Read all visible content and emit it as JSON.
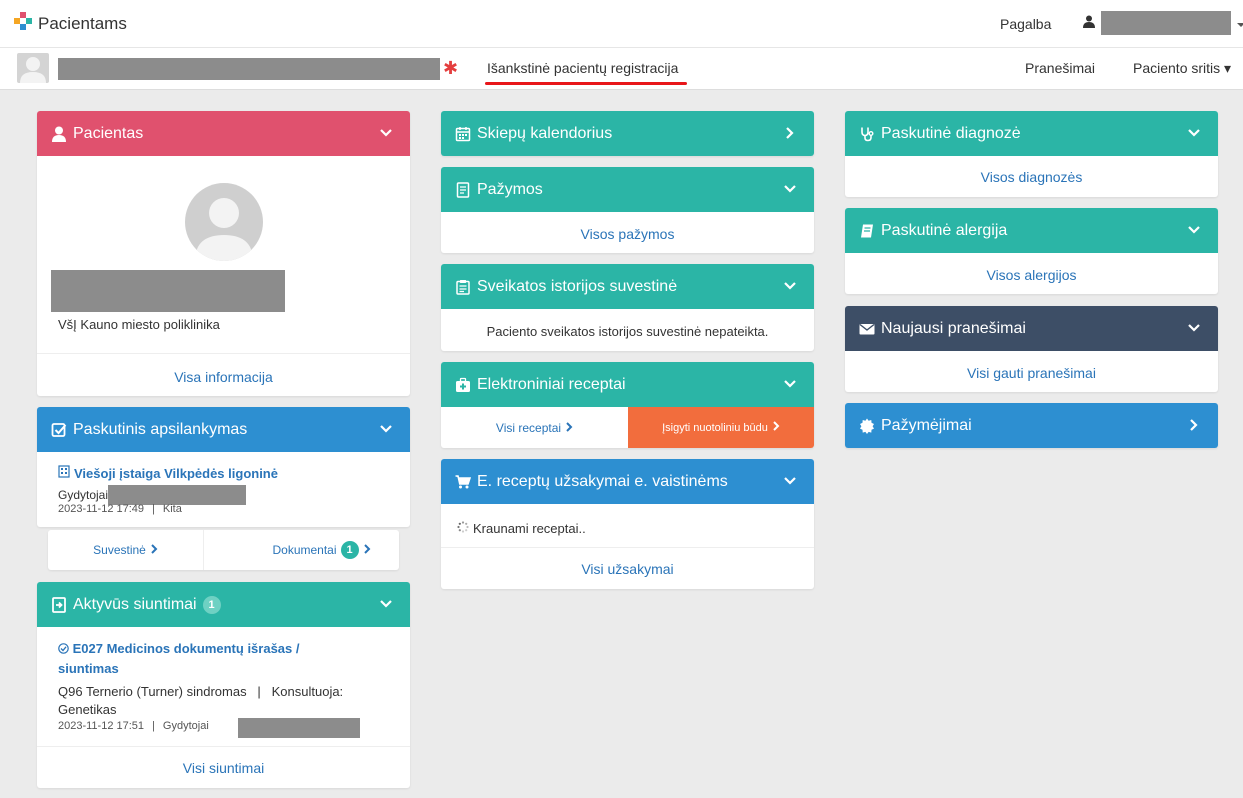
{
  "app": {
    "name": "Pacientams"
  },
  "topbar": {
    "help": "Pagalba"
  },
  "subbar": {
    "prereg": "Išankstinė pacientų registracija",
    "notifications": "Pranešimai",
    "patient_area": "Paciento sritis"
  },
  "colors": {
    "teal": "#2bb5a6",
    "pink": "#e0516e",
    "blue": "#2d8fd1",
    "navy": "#3d4e66",
    "orange": "#f26d3d",
    "link": "#2a74b8"
  },
  "patient": {
    "title": "Pacientas",
    "institution": "VšĮ Kauno miesto poliklinika",
    "more": "Visa informacija"
  },
  "last_visit": {
    "title": "Paskutinis apsilankymas",
    "institution": "Viešoji įstaiga Vilkpėdės ligoninė",
    "doctor_label": "Gydytojai",
    "date": "2023-11-12 17:49",
    "sep": "|",
    "type": "Kita",
    "summary": "Suvestinė",
    "documents": "Dokumentai",
    "documents_count": "1"
  },
  "referrals": {
    "title": "Aktyvūs siuntimai",
    "count": "1",
    "item_title": "E027 Medicinos dokumentų išrašas / siuntimas",
    "item_desc": "Q96 Ternerio (Turner) sindromas   |   Konsultuoja: Genetikas",
    "item_date": "2023-11-12 17:51",
    "sep": "|",
    "doctor_label": "Gydytojai",
    "more": "Visi siuntimai"
  },
  "vaccines": {
    "title": "Skiepų kalendorius"
  },
  "certificates": {
    "title": "Pažymos",
    "more": "Visos pažymos"
  },
  "history": {
    "title": "Sveikatos istorijos suvestinė",
    "text": "Paciento sveikatos istorijos suvestinė nepateikta."
  },
  "prescriptions": {
    "title": "Elektroniniai receptai",
    "all": "Visi receptai",
    "buy": "Įsigyti nuotoliniu būdu"
  },
  "orders": {
    "title": "E. receptų užsakymai e. vaistinėms",
    "loading": "Kraunami receptai..",
    "more": "Visi užsakymai"
  },
  "diagnosis": {
    "title": "Paskutinė diagnozė",
    "more": "Visos diagnozės"
  },
  "allergy": {
    "title": "Paskutinė alergija",
    "more": "Visos alergijos"
  },
  "messages": {
    "title": "Naujausi pranešimai",
    "more": "Visi gauti pranešimai"
  },
  "ids": {
    "title": "Pažymėjimai"
  },
  "icons": [
    "logo-cross-icon",
    "user-icon",
    "caret-down-icon",
    "avatar-icon",
    "chevron-down-icon",
    "chevron-right-icon",
    "calendar-icon",
    "document-icon",
    "clipboard-icon",
    "medkit-icon",
    "cart-icon",
    "stethoscope-icon",
    "book-icon",
    "envelope-icon",
    "certificate-icon",
    "check-square-icon",
    "hospital-icon",
    "check-circle-icon",
    "spinner-icon",
    "file-import-icon"
  ]
}
